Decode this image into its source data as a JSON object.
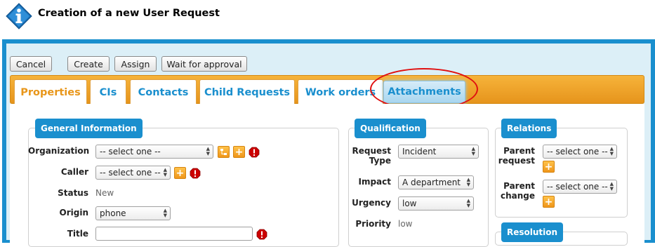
{
  "page": {
    "title": "Creation of a new User Request"
  },
  "toolbar": {
    "cancel": "Cancel",
    "create": "Create",
    "assign": "Assign",
    "wait": "Wait for approval"
  },
  "tabs": [
    {
      "label": "Properties",
      "active": true
    },
    {
      "label": "CIs"
    },
    {
      "label": "Contacts"
    },
    {
      "label": "Child Requests"
    },
    {
      "label": "Work orders"
    },
    {
      "label": "Attachments",
      "highlighted": true
    }
  ],
  "general": {
    "legend": "General Information",
    "organization_label": "Organization",
    "organization_value": "-- select one --",
    "caller_label": "Caller",
    "caller_value": "-- select one --",
    "status_label": "Status",
    "status_value": "New",
    "origin_label": "Origin",
    "origin_value": "phone",
    "title_label": "Title"
  },
  "qualification": {
    "legend": "Qualification",
    "request_type_label_1": "Request",
    "request_type_label_2": "Type",
    "request_type_value": "Incident",
    "impact_label": "Impact",
    "impact_value": "A department",
    "urgency_label": "Urgency",
    "urgency_value": "low",
    "priority_label": "Priority",
    "priority_value": "low"
  },
  "relations": {
    "legend": "Relations",
    "parent_request_label_1": "Parent",
    "parent_request_label_2": "request",
    "parent_request_value": "-- select one --",
    "parent_change_label_1": "Parent",
    "parent_change_label_2": "change",
    "parent_change_value": "-- select one --"
  },
  "resolution": {
    "legend": "Resolution"
  },
  "colors": {
    "accent": "#1a8fce",
    "tabbar": "#f0a028",
    "active_tab": "#e8961a",
    "mandatory": "#cc0000"
  }
}
